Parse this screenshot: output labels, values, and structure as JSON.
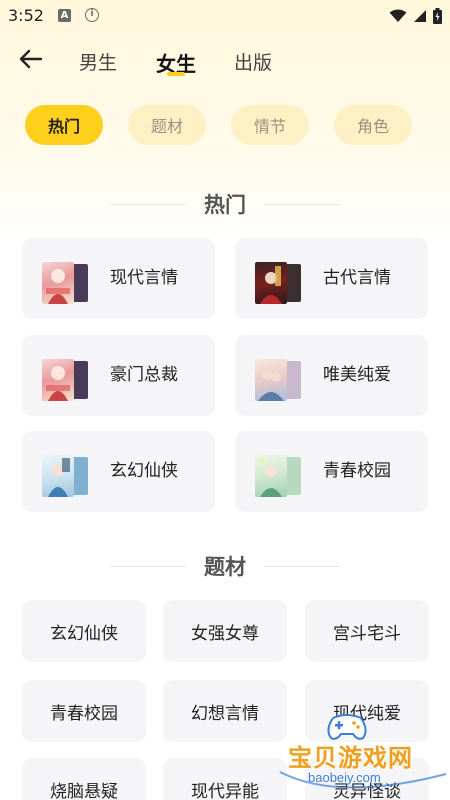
{
  "status_bar": {
    "time": "3:52",
    "a_badge": "A",
    "info_badge": "i"
  },
  "header": {
    "tabs": [
      {
        "label": "男生"
      },
      {
        "label": "女生"
      },
      {
        "label": "出版"
      }
    ],
    "active_tab": "女生"
  },
  "filters": [
    {
      "label": "热门",
      "active": true
    },
    {
      "label": "题材",
      "active": false
    },
    {
      "label": "情节",
      "active": false
    },
    {
      "label": "角色",
      "active": false
    }
  ],
  "hot_section": {
    "title": "热门",
    "items": [
      {
        "label": "现代言情"
      },
      {
        "label": "古代言情"
      },
      {
        "label": "豪门总裁"
      },
      {
        "label": "唯美纯爱"
      },
      {
        "label": "玄幻仙侠"
      },
      {
        "label": "青春校园"
      }
    ]
  },
  "topic_section": {
    "title": "题材",
    "items": [
      {
        "label": "玄幻仙侠"
      },
      {
        "label": "女强女尊"
      },
      {
        "label": "宫斗宅斗"
      },
      {
        "label": "青春校园"
      },
      {
        "label": "幻想言情"
      },
      {
        "label": "现代纯爱"
      },
      {
        "label": "烧脑悬疑"
      },
      {
        "label": "现代异能"
      },
      {
        "label": "灵异怪谈"
      }
    ]
  },
  "watermark": {
    "title": "宝贝游戏网",
    "url": "baobeiy.com"
  },
  "colors": {
    "accent": "#ffcf1e",
    "chip_inactive": "#fdf0c4",
    "card_bg": "#f5f5f7"
  }
}
